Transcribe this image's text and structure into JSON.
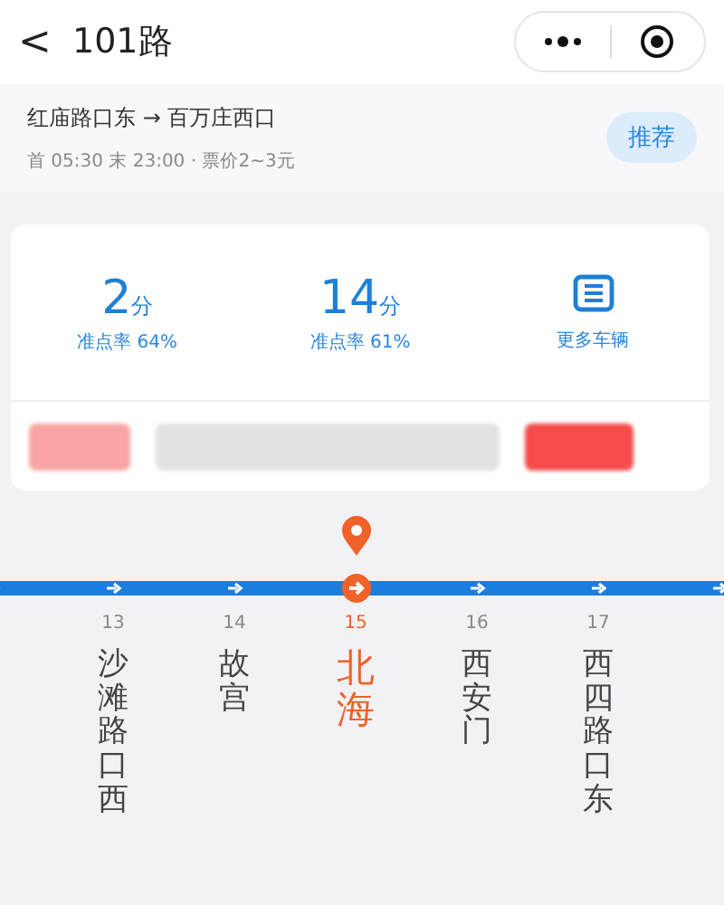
{
  "header": {
    "back": "<",
    "title": "101路"
  },
  "route": {
    "from_to": "红庙路口东 → 百万庄西口",
    "schedule": "首 05:30 末 23:00 · 票价2~3元",
    "button": "推荐"
  },
  "arrivals": [
    {
      "kind": "eta",
      "value": "2",
      "unit": "分",
      "note": "准点率 64%"
    },
    {
      "kind": "eta",
      "value": "14",
      "unit": "分",
      "note": "准点率 61%"
    },
    {
      "kind": "more",
      "note": "更多车辆"
    }
  ],
  "stations": [
    {
      "kind": "edge"
    },
    {
      "kind": "stop",
      "number": "13",
      "name": "沙滩路口西",
      "selected": false
    },
    {
      "kind": "stop",
      "number": "14",
      "name": "故宫",
      "selected": false
    },
    {
      "kind": "stop",
      "number": "15",
      "name": "北海",
      "selected": true
    },
    {
      "kind": "stop",
      "number": "16",
      "name": "西安门",
      "selected": false
    },
    {
      "kind": "stop",
      "number": "17",
      "name": "西四路口东",
      "selected": false
    },
    {
      "kind": "edge"
    }
  ]
}
